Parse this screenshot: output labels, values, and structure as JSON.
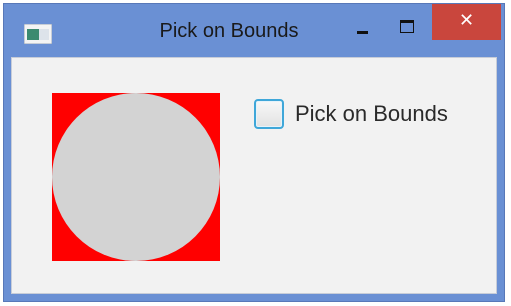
{
  "window": {
    "title": "Pick on Bounds",
    "close_glyph": "✕",
    "minimize_icon": "minimize-icon",
    "maximize_icon": "maximize-icon"
  },
  "checkbox": {
    "label": "Pick on Bounds",
    "checked": false
  },
  "colors": {
    "titlebar": "#6a90d4",
    "close_button": "#c9463d",
    "rectangle_fill": "#ff0000",
    "circle_fill": "#d3d3d3",
    "client_background": "#f2f2f2",
    "checkbox_border": "#3fa7d9"
  }
}
